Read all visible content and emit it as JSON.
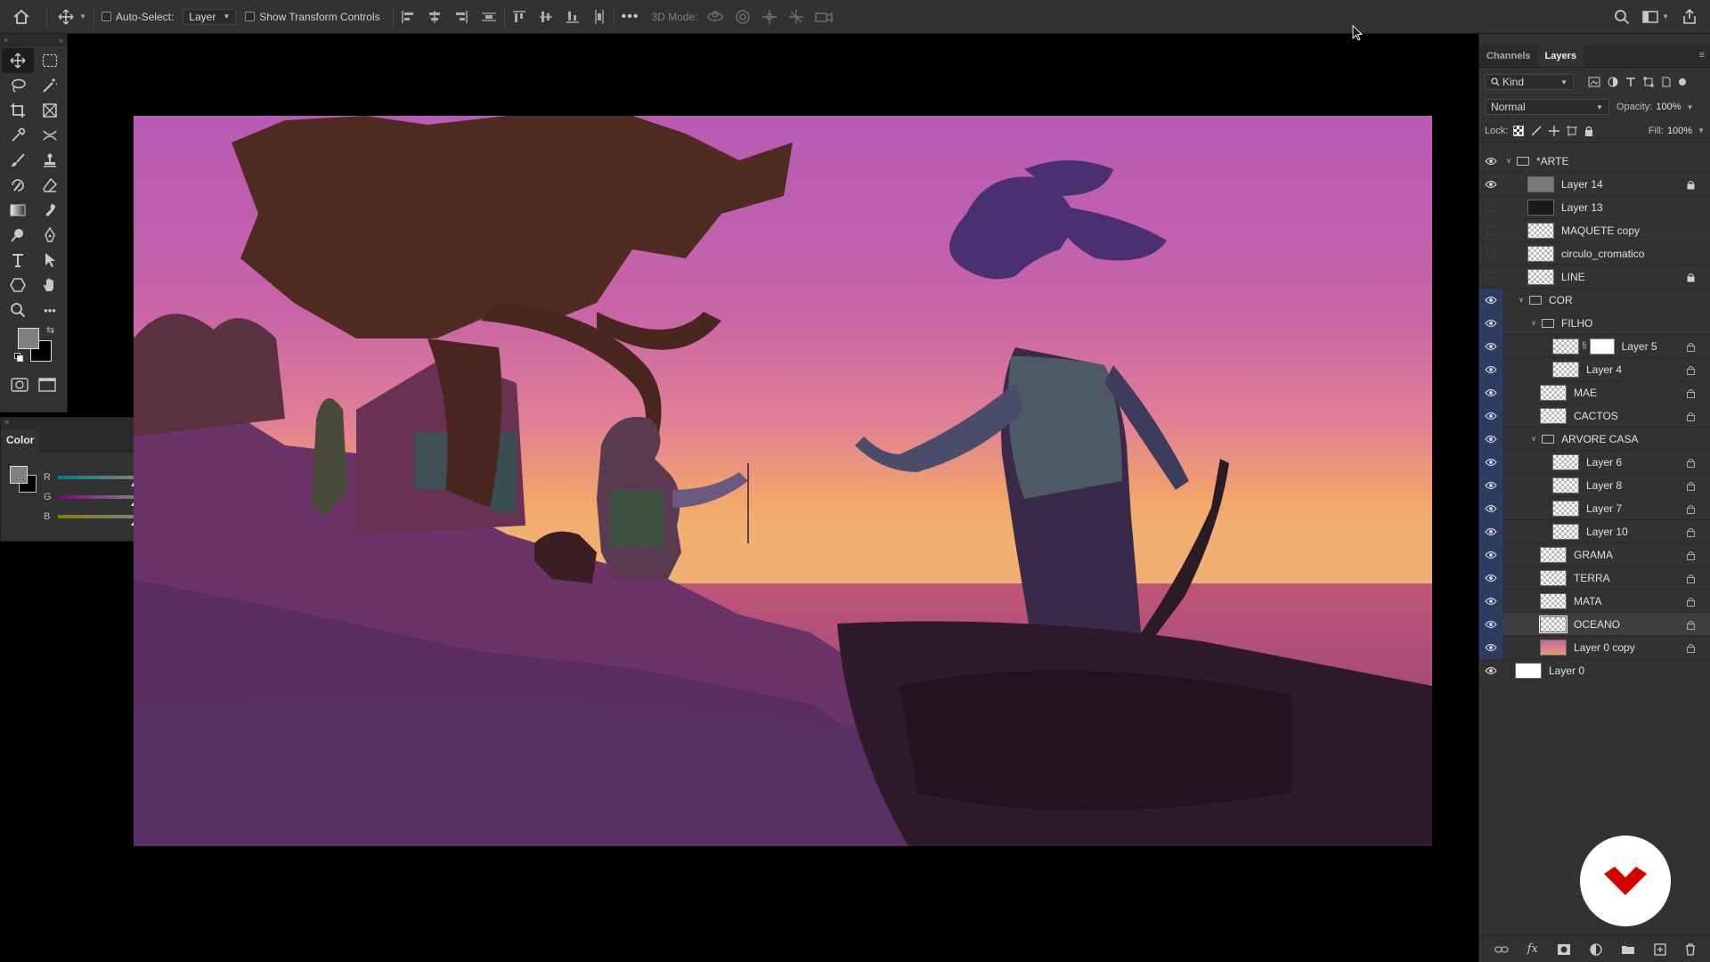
{
  "options_bar": {
    "auto_select_label": "Auto-Select:",
    "auto_select_value": "Layer",
    "show_transform_label": "Show Transform Controls",
    "mode_3d_label": "3D Mode:"
  },
  "color_panel": {
    "title": "Color",
    "sliders": [
      {
        "label": "R",
        "value": "128"
      },
      {
        "label": "G",
        "value": "128"
      },
      {
        "label": "B",
        "value": "128"
      }
    ]
  },
  "right_panel": {
    "tabs": [
      "Channels",
      "Layers"
    ],
    "active_tab": "Layers",
    "filter_kind": "Kind",
    "blend_mode": "Normal",
    "opacity_label": "Opacity:",
    "opacity_value": "100%",
    "lock_label": "Lock:",
    "fill_label": "Fill:",
    "fill_value": "100%",
    "layers": [
      {
        "name": "*ARTE",
        "type": "group",
        "indent": 0,
        "visible": true,
        "open": true
      },
      {
        "name": "Layer 14",
        "type": "layer",
        "indent": 1,
        "visible": true,
        "locked": true,
        "thumb": "gray"
      },
      {
        "name": "Layer 13",
        "type": "layer",
        "indent": 1,
        "visible": false,
        "locked": false,
        "thumb": "dark"
      },
      {
        "name": "MAQUETE copy",
        "type": "layer",
        "indent": 1,
        "visible": false,
        "locked": false,
        "thumb": "checker"
      },
      {
        "name": "circulo_cromatico",
        "type": "layer",
        "indent": 1,
        "visible": false,
        "locked": false,
        "thumb": "checker"
      },
      {
        "name": "LINE",
        "type": "layer",
        "indent": 1,
        "visible": false,
        "locked": true,
        "thumb": "checker"
      },
      {
        "name": "COR",
        "type": "group",
        "indent": 1,
        "visible": true,
        "open": true
      },
      {
        "name": "FILHO",
        "type": "group",
        "indent": 2,
        "visible": true,
        "open": true
      },
      {
        "name": "Layer 5",
        "type": "layer",
        "indent": 3,
        "visible": true,
        "locked": true,
        "thumb": "checker",
        "mask": true
      },
      {
        "name": "Layer 4",
        "type": "layer",
        "indent": 3,
        "visible": true,
        "locked": true,
        "thumb": "checker"
      },
      {
        "name": "MAE",
        "type": "layer",
        "indent": 2,
        "visible": true,
        "locked": true,
        "thumb": "checker"
      },
      {
        "name": "CACTOS",
        "type": "layer",
        "indent": 2,
        "visible": true,
        "locked": true,
        "thumb": "checker"
      },
      {
        "name": "ARVORE CASA",
        "type": "group",
        "indent": 2,
        "visible": true,
        "open": true
      },
      {
        "name": "Layer 6",
        "type": "layer",
        "indent": 3,
        "visible": true,
        "locked": true,
        "thumb": "checker"
      },
      {
        "name": "Layer 8",
        "type": "layer",
        "indent": 3,
        "visible": true,
        "locked": true,
        "thumb": "checker"
      },
      {
        "name": "Layer 7",
        "type": "layer",
        "indent": 3,
        "visible": true,
        "locked": true,
        "thumb": "checker"
      },
      {
        "name": "Layer 10",
        "type": "layer",
        "indent": 3,
        "visible": true,
        "locked": true,
        "thumb": "checker"
      },
      {
        "name": "GRAMA",
        "type": "layer",
        "indent": 2,
        "visible": true,
        "locked": true,
        "thumb": "checker"
      },
      {
        "name": "TERRA",
        "type": "layer",
        "indent": 2,
        "visible": true,
        "locked": true,
        "thumb": "checker"
      },
      {
        "name": "MATA",
        "type": "layer",
        "indent": 2,
        "visible": true,
        "locked": true,
        "thumb": "checker"
      },
      {
        "name": "OCEANO",
        "type": "layer",
        "indent": 2,
        "visible": true,
        "locked": true,
        "thumb": "checker",
        "selected": true
      },
      {
        "name": "Layer 0 copy",
        "type": "layer",
        "indent": 2,
        "visible": true,
        "locked": true,
        "thumb": "sunset"
      },
      {
        "name": "Layer 0",
        "type": "layer",
        "indent": 0,
        "visible": true,
        "locked": false,
        "thumb": "white"
      }
    ]
  },
  "colors": {
    "panel_bg": "#323232",
    "sky_top": "#b85ab8",
    "sky_mid": "#d46aa0",
    "sky_low": "#f0a860",
    "ground": "#5a2d5e",
    "badge_red": "#d40000"
  }
}
